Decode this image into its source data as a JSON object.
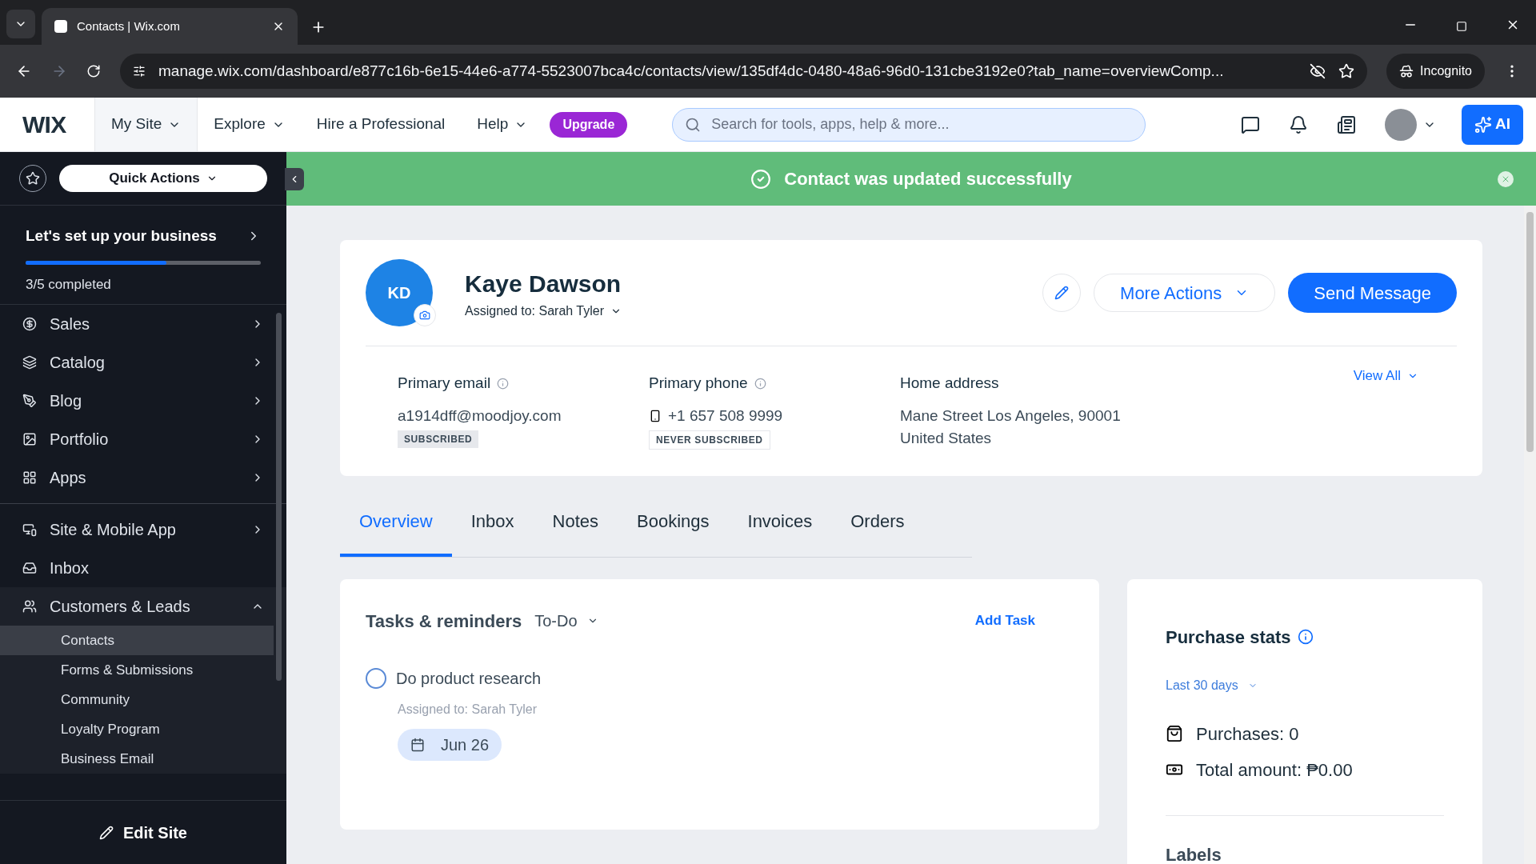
{
  "browser": {
    "tabs": [
      {
        "title": "Contacts | Wix.com",
        "selected": true
      }
    ],
    "url": "manage.wix.com/dashboard/e877c16b-6e15-44e6-a774-5523007bca4c/contacts/view/135df4dc-0480-48a6-96d0-131cbe3192e0?tab_name=overviewComp...",
    "incognito": "Incognito"
  },
  "header": {
    "logo": "WIX",
    "nav": [
      {
        "label": "My Site",
        "caret": true,
        "selected": true
      },
      {
        "label": "Explore",
        "caret": true,
        "selected": false
      },
      {
        "label": "Hire a Professional",
        "caret": false,
        "selected": false
      },
      {
        "label": "Help",
        "caret": true,
        "selected": false
      }
    ],
    "upgrade": "Upgrade",
    "search_placeholder": "Search for tools, apps, help & more...",
    "ai": "AI"
  },
  "banner": {
    "message": "Contact was updated successfully"
  },
  "sidebar": {
    "quick_actions": "Quick Actions",
    "setup": {
      "title": "Let's set up your business",
      "level": 0.6,
      "progress": "3/5 completed"
    },
    "sections": [
      [
        {
          "label": "Sales",
          "kind": "group",
          "expanded": false
        },
        {
          "label": "Catalog",
          "kind": "group",
          "expanded": false
        },
        {
          "label": "Blog",
          "kind": "group",
          "expanded": false
        },
        {
          "label": "Portfolio",
          "kind": "group",
          "expanded": false
        },
        {
          "label": "Apps",
          "kind": "group",
          "expanded": false
        }
      ],
      [
        {
          "label": "Site & Mobile App",
          "kind": "group",
          "expanded": false
        },
        {
          "label": "Inbox",
          "kind": "link"
        },
        {
          "label": "Customers & Leads",
          "kind": "group",
          "expanded": true,
          "children": [
            {
              "label": "Contacts",
              "selected": true
            },
            {
              "label": "Forms & Submissions",
              "selected": false
            },
            {
              "label": "Community",
              "selected": false
            },
            {
              "label": "Loyalty Program",
              "selected": false
            },
            {
              "label": "Business Email",
              "selected": false
            }
          ]
        }
      ]
    ],
    "edit_site": "Edit Site"
  },
  "contact": {
    "initials": "KD",
    "name": "Kaye Dawson",
    "assigned": "Assigned to: Sarah Tyler",
    "more_actions": "More Actions",
    "send_message": "Send Message",
    "view_all": "View All",
    "fields": [
      {
        "kind": "email",
        "label": "Primary email",
        "lines": [
          "a1914dff@moodjoy.com"
        ],
        "badge": "SUBSCRIBED"
      },
      {
        "kind": "phone",
        "label": "Primary phone",
        "lines": [
          "+1 657 508 9999"
        ],
        "badge": "NEVER SUBSCRIBED"
      },
      {
        "kind": "address",
        "label": "Home address",
        "lines": [
          "Mane Street Los Angeles, 90001",
          "United States"
        ]
      }
    ]
  },
  "tabs": [
    {
      "label": "Overview",
      "selected": true
    },
    {
      "label": "Inbox",
      "selected": false
    },
    {
      "label": "Notes",
      "selected": false
    },
    {
      "label": "Bookings",
      "selected": false
    },
    {
      "label": "Invoices",
      "selected": false
    },
    {
      "label": "Orders",
      "selected": false
    }
  ],
  "tasks": {
    "title": "Tasks & reminders",
    "filter": "To-Do",
    "add": "Add Task",
    "items": [
      {
        "title": "Do product research",
        "assigned": "Assigned to: Sarah Tyler",
        "due": "Jun 26",
        "done": false
      }
    ]
  },
  "purchase_stats": {
    "title": "Purchase stats",
    "period": "Last 30 days",
    "rows": [
      {
        "kind": "purchases",
        "text": "Purchases: 0"
      },
      {
        "kind": "total",
        "text": "Total amount: ₱0.00"
      }
    ],
    "labels_title": "Labels"
  }
}
